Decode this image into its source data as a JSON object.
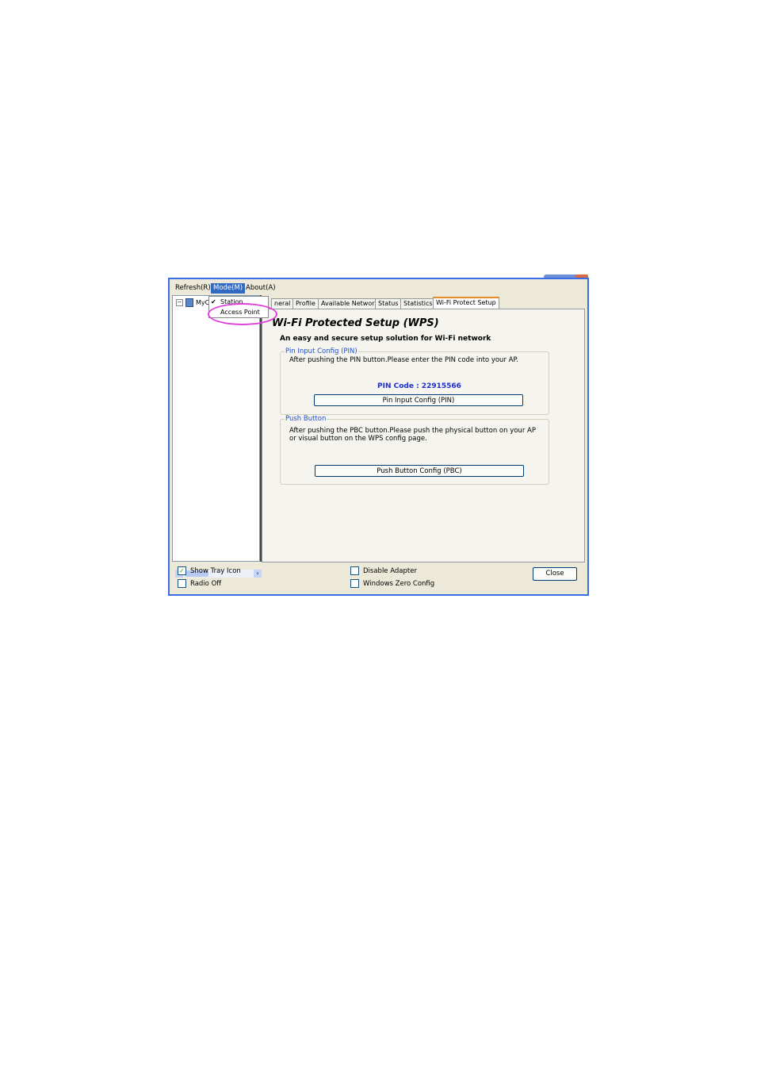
{
  "menubar": {
    "items": [
      {
        "label": "Refresh(R)"
      },
      {
        "label": "Mode(M)"
      },
      {
        "label": "About(A)"
      }
    ]
  },
  "tree": {
    "node_label": "MyC"
  },
  "mode_menu": {
    "items": [
      {
        "label": "Station",
        "checked": true
      },
      {
        "label": "Access Point",
        "checked": false
      }
    ],
    "check_glyph": "✔"
  },
  "tabs": [
    {
      "label": "neral"
    },
    {
      "label": "Profile"
    },
    {
      "label": "Available Network"
    },
    {
      "label": "Status"
    },
    {
      "label": "Statistics"
    },
    {
      "label": "Wi-Fi Protect Setup",
      "active": true
    }
  ],
  "wps": {
    "title": "Wi-Fi Protected Setup (WPS)",
    "subtitle": "An easy and secure setup solution for Wi-Fi network",
    "pin_group": {
      "title": "Pin Input Config (PIN)",
      "description": "After pushing the PIN button.Please enter the PIN code into your AP.",
      "pin_code": "PIN Code :  22915566",
      "button_label": "Pin Input Config (PIN)"
    },
    "push_group": {
      "title": "Push Button",
      "description_line1": "After pushing the PBC button.Please push the physical button on your AP",
      "description_line2": "or visual button on the WPS config page.",
      "button_label": "Push Button Config (PBC)"
    }
  },
  "footer": {
    "show_tray_icon": {
      "label": "Show Tray Icon",
      "checked": true
    },
    "radio_off": {
      "label": "Radio Off",
      "checked": false
    },
    "disable_adapter": {
      "label": "Disable Adapter",
      "checked": false
    },
    "windows_zero_config": {
      "label": "Windows Zero Config",
      "checked": false
    },
    "close_label": "Close",
    "check_glyph": "✓"
  },
  "colors": {
    "window_border": "#3a6ee8",
    "menu_active": "#316ac5",
    "group_title": "#1f4fcf",
    "pin_code": "#1c2fd0",
    "highlight_circle": "#e040d8",
    "active_tab_accent": "#e68b2c"
  }
}
